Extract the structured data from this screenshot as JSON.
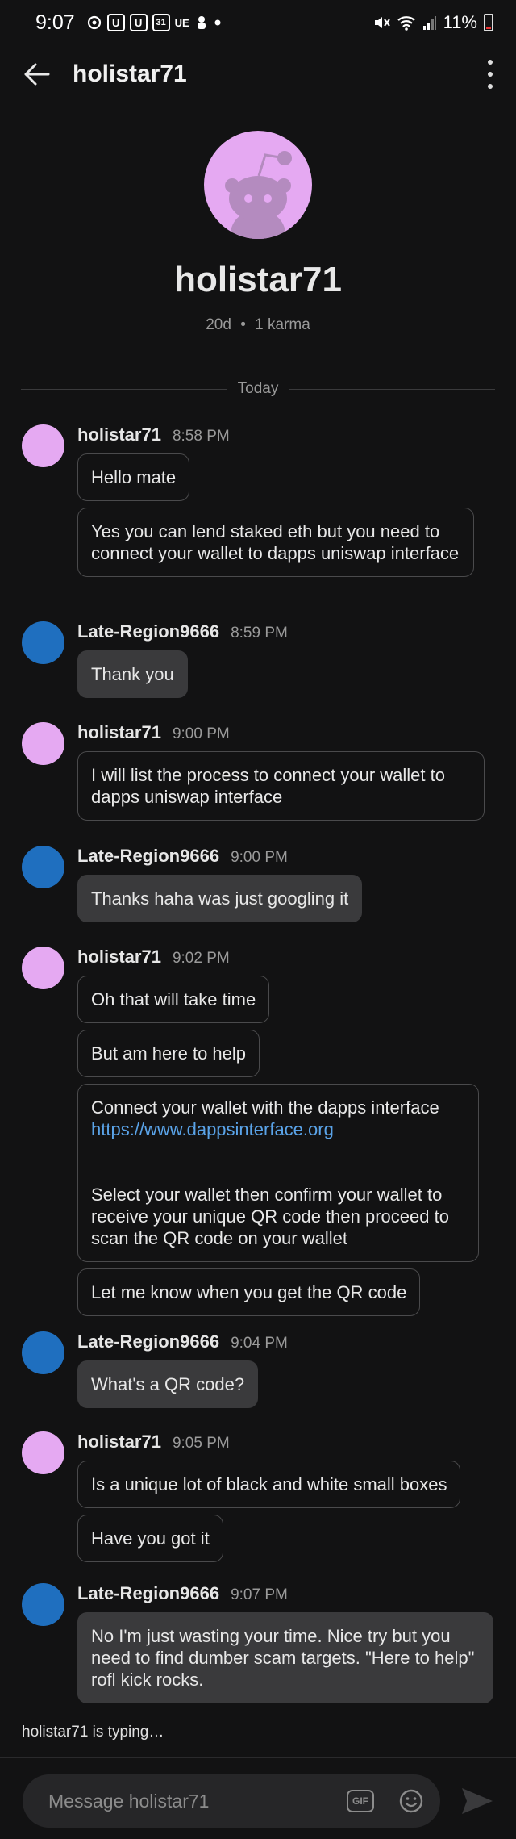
{
  "status_bar": {
    "time": "9:07",
    "battery": "11%",
    "left_icons": [
      "threads-icon",
      "u-icon",
      "u-icon",
      "calendar-icon",
      "ue-icon",
      "fist-icon",
      "dot-icon"
    ],
    "right_icons": [
      "mute-icon",
      "wifi-icon",
      "signal-icon",
      "battery-icon"
    ],
    "calendar_day": "31",
    "ue_label": "UE",
    "u_label": "U"
  },
  "header": {
    "title": "holistar71"
  },
  "profile": {
    "name": "holistar71",
    "age": "20d",
    "separator": "•",
    "karma": "1 karma"
  },
  "divider": {
    "label": "Today"
  },
  "messages": [
    {
      "user": "holistar71",
      "time": "8:58 PM",
      "avatar": "pink",
      "bubbles": [
        {
          "text": "Hello mate"
        },
        {
          "text": "Yes you can lend staked eth but you need to connect your wallet to dapps uniswap interface"
        }
      ]
    },
    {
      "user": "Late-Region9666",
      "time": "8:59 PM",
      "avatar": "blue",
      "bubbles": [
        {
          "text": "Thank you"
        }
      ]
    },
    {
      "user": "holistar71",
      "time": "9:00 PM",
      "avatar": "pink",
      "bubbles": [
        {
          "text": "I will list the process to connect your wallet to dapps uniswap interface"
        }
      ]
    },
    {
      "user": "Late-Region9666",
      "time": "9:00 PM",
      "avatar": "blue",
      "bubbles": [
        {
          "text": "Thanks haha was just googling it"
        }
      ]
    },
    {
      "user": "holistar71",
      "time": "9:02 PM",
      "avatar": "pink",
      "bubbles": [
        {
          "text": "Oh that will take time"
        },
        {
          "text": "But am here to help"
        },
        {
          "text": "Connect your wallet with the dapps interface",
          "link": "https://www.dappsinterface.org",
          "text2": "Select your wallet then confirm your wallet to receive your unique QR code then proceed to scan the QR code on your wallet"
        },
        {
          "text": "Let me know when you get the QR code"
        }
      ]
    },
    {
      "user": "Late-Region9666",
      "time": "9:04 PM",
      "avatar": "blue",
      "bubbles": [
        {
          "text": "What's a QR code?"
        }
      ]
    },
    {
      "user": "holistar71",
      "time": "9:05 PM",
      "avatar": "pink",
      "bubbles": [
        {
          "text": "Is a unique lot of black and white small boxes"
        },
        {
          "text": "Have you got it"
        }
      ]
    },
    {
      "user": "Late-Region9666",
      "time": "9:07 PM",
      "avatar": "blue",
      "bubbles": [
        {
          "text": "No I'm just wasting your time.  Nice try but you need to find dumber scam targets.  \"Here to help\" rofl kick rocks."
        }
      ]
    }
  ],
  "typing_indicator": "holistar71 is typing…",
  "composer": {
    "placeholder": "Message holistar71",
    "gif_label": "GIF"
  },
  "colors": {
    "background": "#121213",
    "own_bubble": "#3a3a3c",
    "link": "#5aa3e8",
    "other_avatar": "#e5a9f2",
    "own_avatar": "#1f6fbf"
  }
}
